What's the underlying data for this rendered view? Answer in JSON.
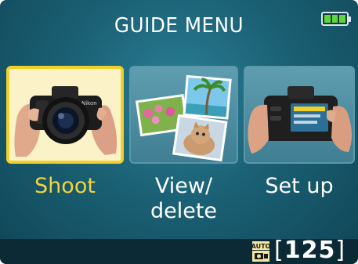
{
  "header": {
    "title": "GUIDE MENU",
    "battery_icon": "battery-full-icon"
  },
  "menu": {
    "items": [
      {
        "label": "Shoot",
        "icon": "hands-holding-camera-icon",
        "selected": true
      },
      {
        "label": "View/\ndelete",
        "icon": "photo-stack-icon",
        "selected": false
      },
      {
        "label": "Set up",
        "icon": "camera-rear-screen-icon",
        "selected": false
      }
    ]
  },
  "footer": {
    "mode_icon": "auto-mode-icon",
    "mode_text": "AUTO",
    "bracket_open": "[",
    "shots_remaining": "125",
    "bracket_close": "]"
  },
  "colors": {
    "selected_border": "#f2d02a",
    "selected_label": "#f3d43c",
    "background": "#1b6074"
  }
}
